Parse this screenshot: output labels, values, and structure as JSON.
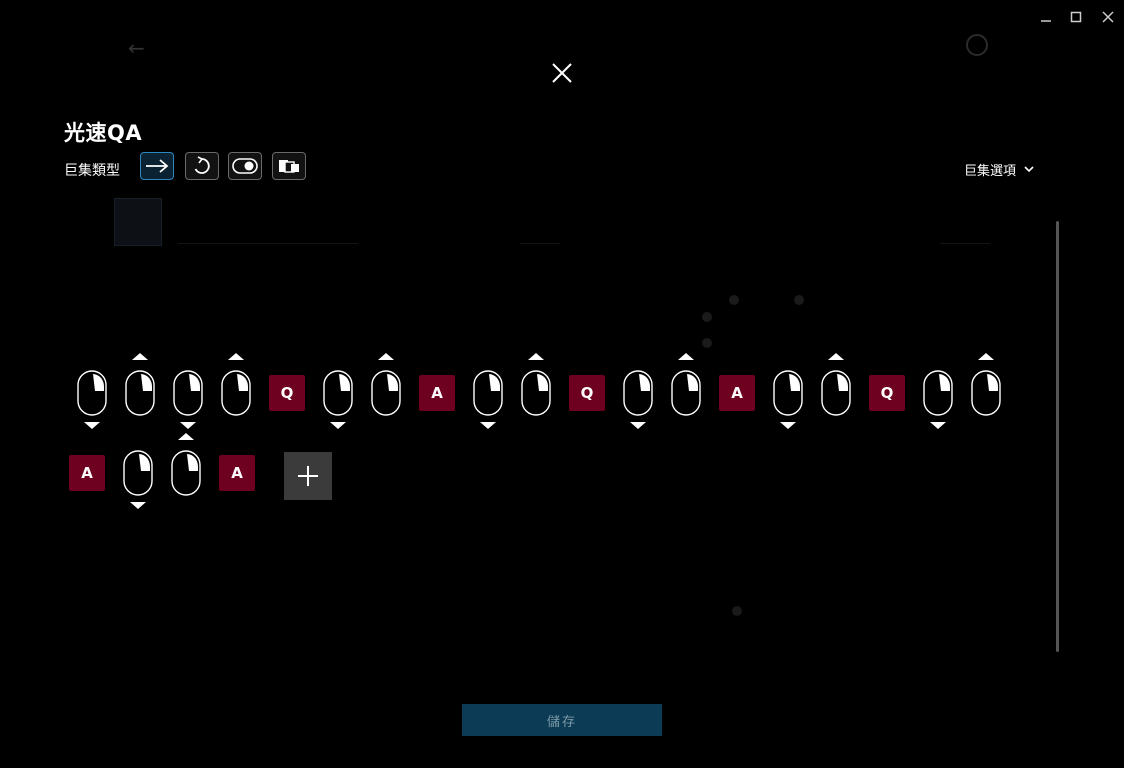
{
  "window": {
    "controls": [
      "minimize-icon",
      "maximize-icon",
      "close-icon"
    ]
  },
  "modal": {
    "title": "光速QA",
    "macro_type_label": "巨集類型",
    "macro_types": [
      {
        "name": "standard",
        "icon": "arrow-right-icon",
        "active": true
      },
      {
        "name": "repeat",
        "icon": "repeat-icon",
        "active": false
      },
      {
        "name": "toggle",
        "icon": "toggle-icon",
        "active": false
      },
      {
        "name": "sequence",
        "icon": "sequence-icon",
        "active": false
      }
    ],
    "options_label": "巨集選項",
    "save_label": "儲存"
  },
  "sequence": {
    "row1": [
      "mouse-release",
      "mouse-press",
      "mouse-release",
      "mouse-press",
      "key-Q",
      "mouse-release",
      "mouse-press",
      "key-A",
      "mouse-release",
      "mouse-press",
      "key-Q",
      "mouse-release",
      "mouse-press",
      "key-A",
      "mouse-release",
      "mouse-press",
      "key-Q",
      "mouse-release",
      "mouse-press"
    ],
    "row2": [
      "key-A",
      "mouse-release",
      "mouse-press",
      "key-A"
    ],
    "key_q": "Q",
    "key_a": "A"
  },
  "colors": {
    "key_bg": "#6e0020",
    "accent": "#2e86c1",
    "save_bg": "#0b3b55"
  }
}
